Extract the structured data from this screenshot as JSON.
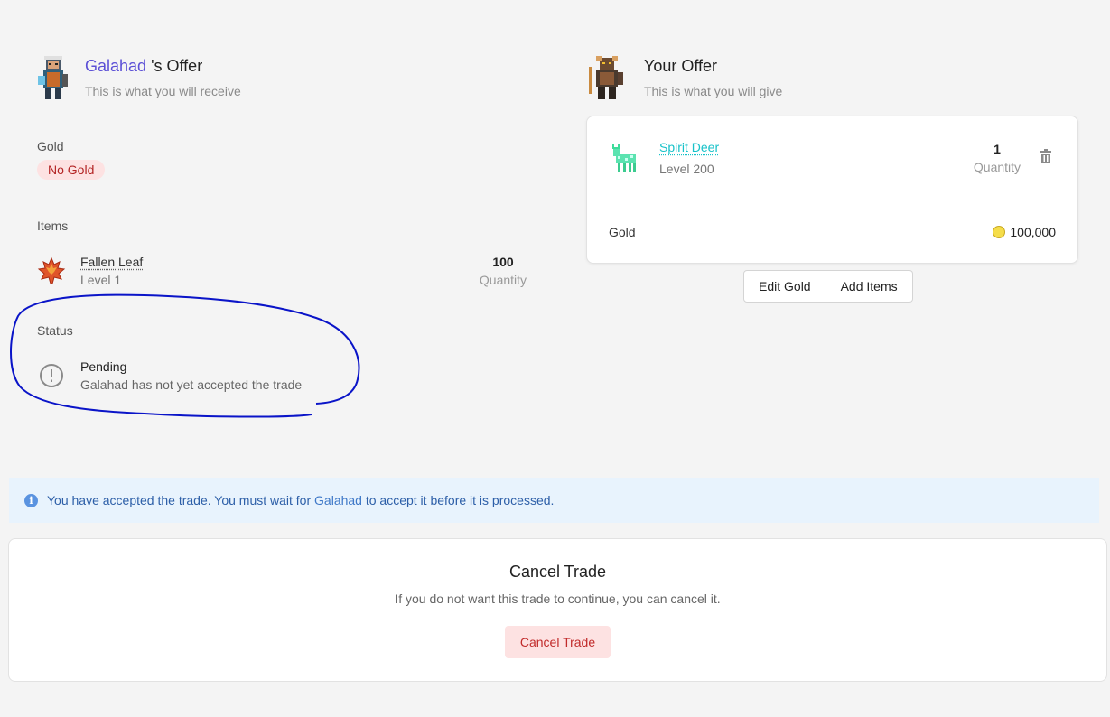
{
  "their_offer": {
    "username": "Galahad",
    "title_suffix": " 's Offer",
    "subtitle": "This is what you will receive",
    "gold_label": "Gold",
    "gold_badge": "No Gold",
    "items_label": "Items",
    "items": [
      {
        "name": "Fallen Leaf",
        "level": "Level 1",
        "quantity": "100",
        "quantity_label": "Quantity",
        "icon": "maple-leaf-icon"
      }
    ],
    "status_label": "Status",
    "status_title": "Pending",
    "status_desc": "Galahad has not yet accepted the trade"
  },
  "your_offer": {
    "title": "Your Offer",
    "subtitle": "This is what you will give",
    "items": [
      {
        "name": "Spirit Deer",
        "level": "Level 200",
        "quantity": "1",
        "quantity_label": "Quantity",
        "icon": "spirit-deer-icon"
      }
    ],
    "gold_label": "Gold",
    "gold_amount": "100,000",
    "edit_gold_label": "Edit Gold",
    "add_items_label": "Add Items"
  },
  "info": {
    "text_before": "You have accepted the trade. You must wait for ",
    "username": "Galahad",
    "text_after": " to accept it before it is processed."
  },
  "cancel": {
    "title": "Cancel Trade",
    "description": "If you do not want this trade to continue, you can cancel it.",
    "button_label": "Cancel Trade"
  },
  "colors": {
    "accent": "#5b4fd6",
    "danger_bg": "#fde2e2",
    "danger_text": "#c12b2b",
    "info_bg": "#e8f3fd",
    "annotation": "#0a14c8"
  }
}
